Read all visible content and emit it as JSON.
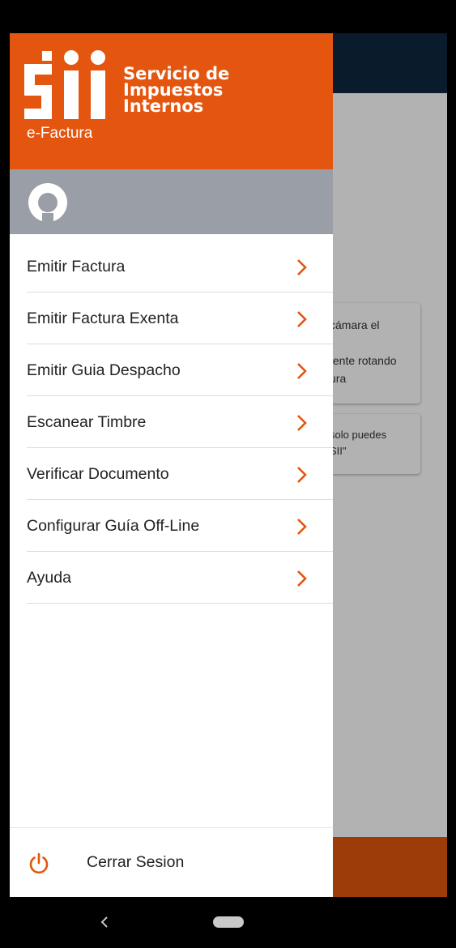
{
  "brand": {
    "org_name_lines": [
      "Servicio de",
      "Impuestos",
      "Internos"
    ],
    "app_name": "e-Factura",
    "header_color": "#e4560f",
    "accent_color": "#e2560e"
  },
  "user": {
    "avatar_icon": "user-avatar-icon"
  },
  "menu": {
    "items": [
      {
        "label": "Emitir Factura",
        "icon": "chevron-right-icon"
      },
      {
        "label": "Emitir Factura Exenta",
        "icon": "chevron-right-icon"
      },
      {
        "label": "Emitir Guia Despacho",
        "icon": "chevron-right-icon"
      },
      {
        "label": "Escanear Timbre",
        "icon": "chevron-right-icon"
      },
      {
        "label": "Verificar Documento",
        "icon": "chevron-right-icon"
      },
      {
        "label": "Configurar Guía Off-Line",
        "icon": "chevron-right-icon"
      },
      {
        "label": "Ayuda",
        "icon": "chevron-right-icon"
      }
    ]
  },
  "logout": {
    "label": "Cerrar Sesion",
    "icon": "power-icon"
  },
  "background_app": {
    "card1_lines": [
      "cámara el",
      "tente rotando",
      "ura"
    ],
    "card2_lines": [
      "solo puedes",
      "SII\""
    ]
  },
  "navigation": {
    "back_icon": "back-icon",
    "home_icon": "home-pill-icon"
  }
}
